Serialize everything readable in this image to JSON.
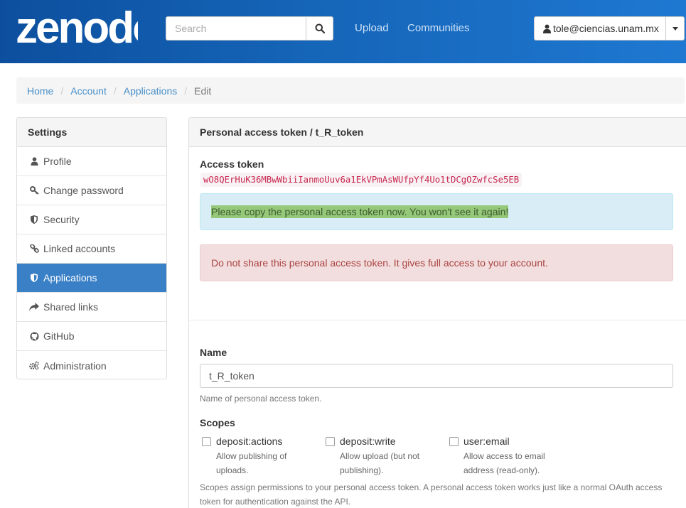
{
  "header": {
    "logo_text": "zenodo",
    "search_placeholder": "Search",
    "nav": [
      {
        "label": "Upload"
      },
      {
        "label": "Communities"
      }
    ],
    "user_email": "tole@ciencias.unam.mx"
  },
  "breadcrumb": {
    "items": [
      "Home",
      "Account",
      "Applications"
    ],
    "active": "Edit",
    "separator": "/"
  },
  "sidebar": {
    "title": "Settings",
    "items": [
      {
        "label": "Profile",
        "icon": "user-icon"
      },
      {
        "label": "Change password",
        "icon": "key-icon"
      },
      {
        "label": "Security",
        "icon": "shield-icon"
      },
      {
        "label": "Linked accounts",
        "icon": "link-icon"
      },
      {
        "label": "Applications",
        "icon": "shield-icon",
        "active": true
      },
      {
        "label": "Shared links",
        "icon": "share-icon"
      },
      {
        "label": "GitHub",
        "icon": "github-icon"
      },
      {
        "label": "Administration",
        "icon": "cogs-icon"
      }
    ]
  },
  "panel": {
    "title": "Personal access token / t_R_token",
    "access_token_label": "Access token",
    "access_token": "wO8QErHuK36MBwWbiiIanmoUuv6a1EkVPmAsWUfpYf4Uo1tDCgOZwfcSe5EB",
    "info_alert": "Please copy the personal access token now. You won't see it again!",
    "danger_alert": "Do not share this personal access token. It gives full access to your account.",
    "name_label": "Name",
    "name_value": "t_R_token",
    "name_help": "Name of personal access token.",
    "scopes_label": "Scopes",
    "scopes": [
      {
        "name": "deposit:actions",
        "desc": "Allow publishing of uploads.",
        "checked": false
      },
      {
        "name": "deposit:write",
        "desc": "Allow upload (but not publishing).",
        "checked": false
      },
      {
        "name": "user:email",
        "desc": "Allow access to email address (read-only).",
        "checked": false
      }
    ],
    "scopes_help": "Scopes assign permissions to your personal access token. A personal access token works just like a normal OAuth access token for authentication against the API."
  },
  "colors": {
    "header_start": "#0d4f9e",
    "header_end": "#1f78d1",
    "active_item": "#3a80c6",
    "link": "#4a90c8",
    "token_text": "#c7254e"
  }
}
